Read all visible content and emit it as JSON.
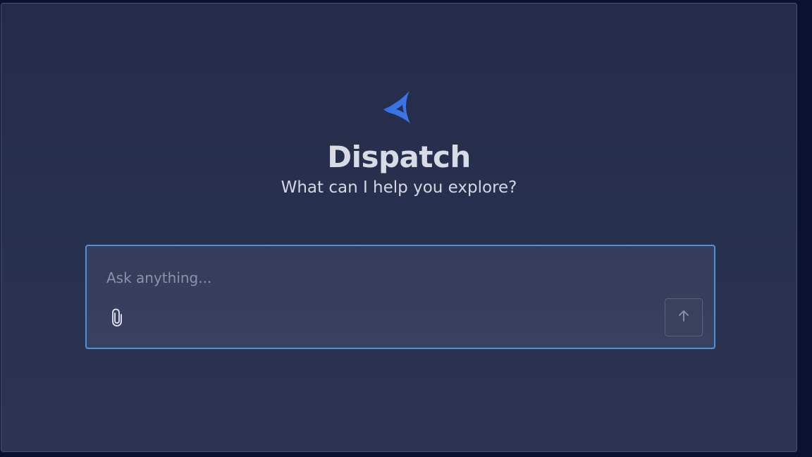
{
  "app": {
    "title": "Dispatch",
    "subtitle": "What can I help you explore?"
  },
  "prompt": {
    "placeholder": "Ask anything...",
    "value": ""
  },
  "icons": {
    "logo": "dispatch-logo-icon",
    "attach": "paperclip-icon",
    "send": "arrow-up-icon"
  },
  "colors": {
    "accent": "#4b93d6",
    "logo": "#3f6fd8",
    "background": "#252c49",
    "text": "#d9dbe4"
  }
}
